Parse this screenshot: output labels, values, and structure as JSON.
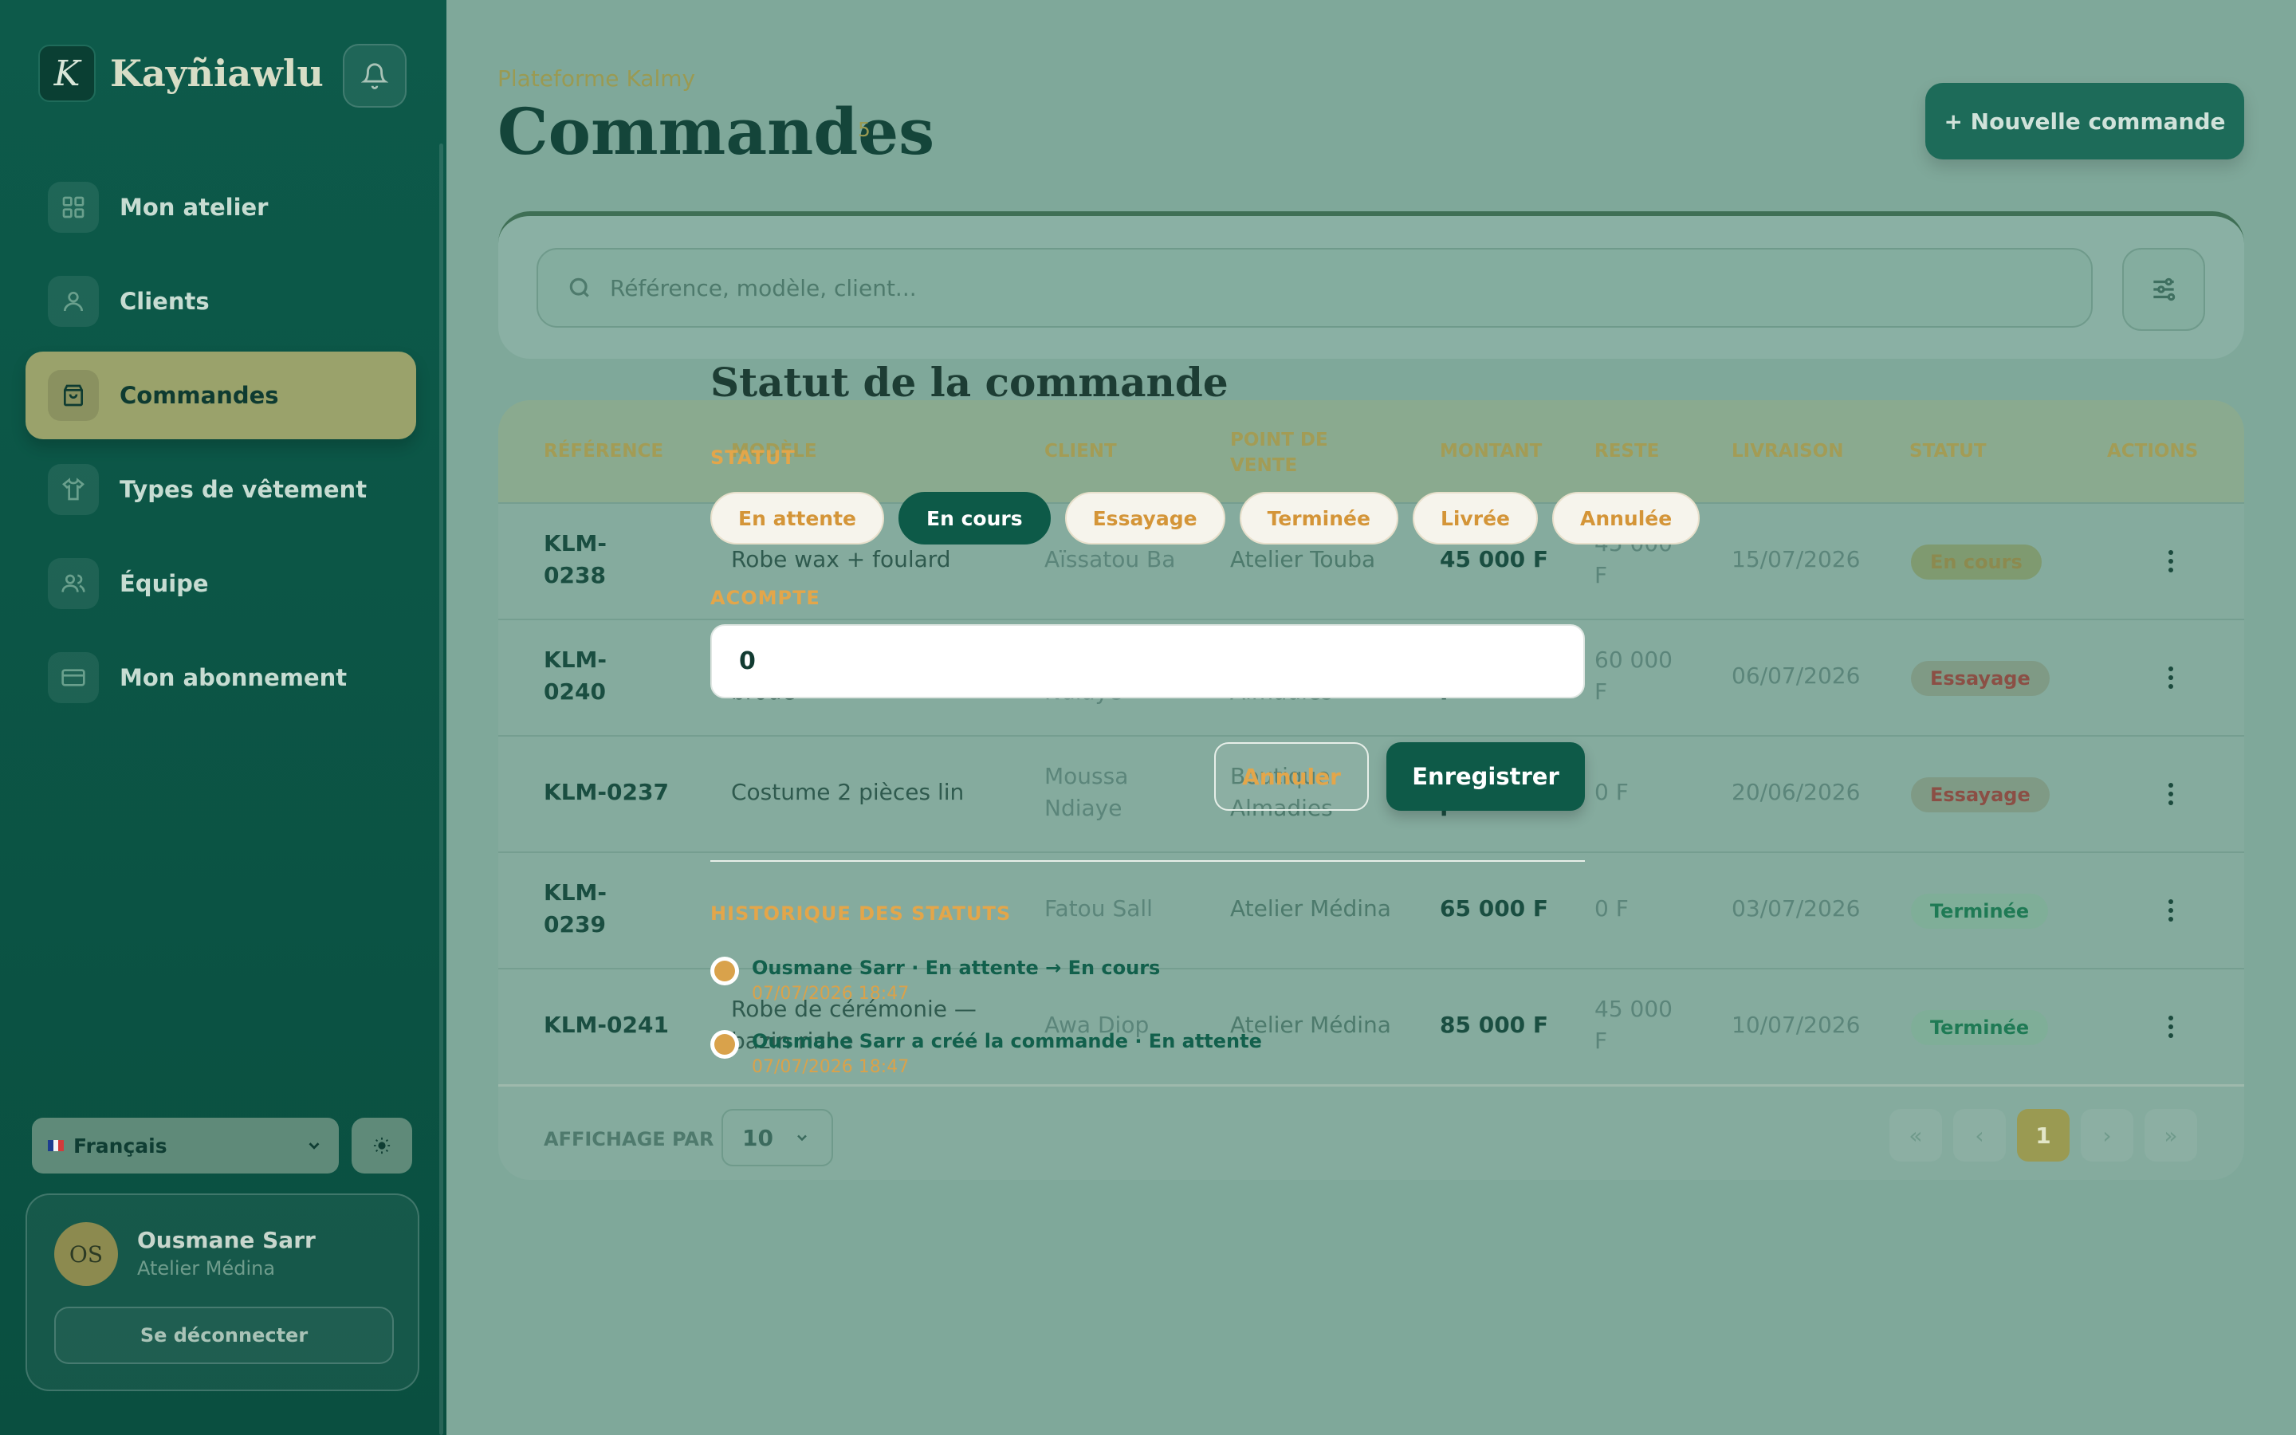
{
  "app": {
    "name": "Kayñiawlu",
    "logo_letter": "K"
  },
  "nav": [
    {
      "label": "Mon atelier",
      "icon": "grid-icon"
    },
    {
      "label": "Clients",
      "icon": "user-icon"
    },
    {
      "label": "Commandes",
      "icon": "bag-icon",
      "active": true
    },
    {
      "label": "Types de vêtement",
      "icon": "shirt-icon"
    },
    {
      "label": "Équipe",
      "icon": "team-icon"
    },
    {
      "label": "Mon abonnement",
      "icon": "card-icon"
    }
  ],
  "language": {
    "selected": "Français"
  },
  "user": {
    "initials": "OS",
    "name": "Ousmane Sarr",
    "shop": "Atelier Médina",
    "logout": "Se déconnecter"
  },
  "page": {
    "breadcrumb": "Plateforme Kalmy",
    "title": "Commandes",
    "count": "5",
    "new_button": "+ Nouvelle commande"
  },
  "search": {
    "placeholder": "Référence, modèle, client..."
  },
  "table": {
    "headers": {
      "ref": "RÉFÉRENCE",
      "model": "MODÈLE",
      "client": "CLIENT",
      "pos_1": "POINT DE",
      "pos_2": "VENTE",
      "amount": "MONTANT",
      "rest": "RESTE",
      "delivery": "LIVRAISON",
      "status": "STATUT",
      "actions": "ACTIONS"
    },
    "rows": [
      {
        "ref1": "KLM-",
        "ref2": "0238",
        "model1": "Robe wax + foulard",
        "model2": "",
        "client1": "Aïssatou Ba",
        "client2": "",
        "pos1": "Atelier Touba",
        "pos2": "",
        "amount": "45 000 F",
        "rest1": "45 000",
        "rest2": "F",
        "delivery": "15/07/2026",
        "status": "En cours"
      },
      {
        "ref1": "KLM-",
        "ref2": "0240",
        "model1": "",
        "model2": "brodé",
        "client1": "",
        "client2": "Ndiaye",
        "pos1": "",
        "pos2": "Almadies",
        "amount": "F",
        "rest1": "60 000",
        "rest2": "F",
        "delivery": "06/07/2026",
        "status": "Essayage"
      },
      {
        "ref1": "KLM-0237",
        "ref2": "",
        "model1": "Costume 2 pièces lin",
        "model2": "",
        "client1": "Moussa",
        "client2": "Ndiaye",
        "pos1": "Boutique",
        "pos2": "Almadies",
        "amount": "F",
        "rest1": "0 F",
        "rest2": "",
        "delivery": "20/06/2026",
        "status": "Essayage"
      },
      {
        "ref1": "KLM-",
        "ref2": "0239",
        "model1": "",
        "model2": "",
        "client1": "Fatou Sall",
        "client2": "",
        "pos1": "Atelier Médina",
        "pos2": "",
        "amount": "65 000 F",
        "rest1": "0 F",
        "rest2": "",
        "delivery": "03/07/2026",
        "status": "Terminée"
      },
      {
        "ref1": "KLM-0241",
        "ref2": "",
        "model1": "Robe de cérémonie —",
        "model2": "bazin riche",
        "client1": "Awa Diop",
        "client2": "",
        "pos1": "Atelier Médina",
        "pos2": "",
        "amount": "85 000 F",
        "rest1": "45 000",
        "rest2": "F",
        "delivery": "10/07/2026",
        "status": "Terminée"
      }
    ],
    "per_page_label": "AFFICHAGE PAR",
    "per_page": "10",
    "pagination": {
      "first": "«",
      "prev": "‹",
      "current": "1",
      "next": "›",
      "last": "»"
    }
  },
  "modal": {
    "title": "Statut de la commande",
    "status_label": "STATUT",
    "statuses": [
      "En attente",
      "En cours",
      "Essayage",
      "Terminée",
      "Livrée",
      "Annulée"
    ],
    "selected_status": "En cours",
    "acompte_label": "ACOMPTE",
    "acompte_value": "0",
    "cancel": "Annuler",
    "save": "Enregistrer",
    "history_label": "HISTORIQUE DES STATUTS",
    "history": [
      {
        "text": "Ousmane Sarr · En attente → En cours",
        "date": "07/07/2026 18:47"
      },
      {
        "text": "Ousmane Sarr a créé la commande · En attente",
        "date": "07/07/2026 18:47"
      }
    ]
  },
  "colors": {
    "sidebar": "#0d5a4a",
    "accent": "#9aa26b",
    "primary": "#0e5a48",
    "gold": "#e3a64a",
    "status_en_cours": "#8c8a4f",
    "status_essayage": "#8b4f45",
    "status_terminee": "#1f7a55"
  }
}
